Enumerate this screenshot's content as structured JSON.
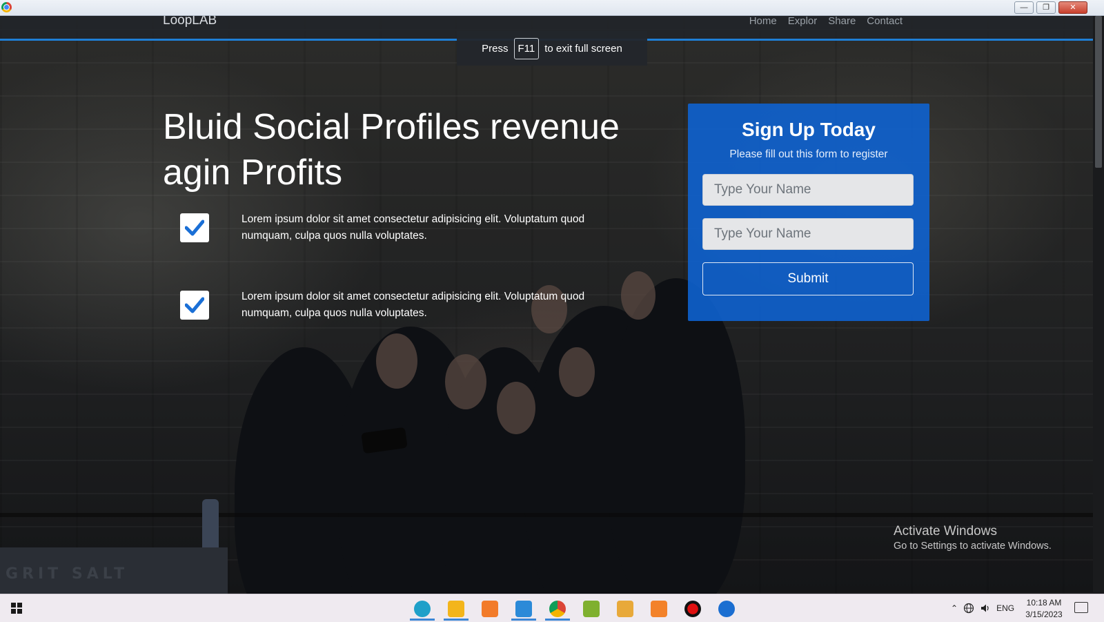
{
  "window": {
    "minimize_glyph": "—",
    "restore_glyph": "❐",
    "close_glyph": "✕"
  },
  "navbar": {
    "brand": "LoopLAB",
    "links": [
      "Home",
      "Explor",
      "Share",
      "Contact"
    ]
  },
  "fullscreen_banner": {
    "before": "Press",
    "key": "F11",
    "after": "to exit full screen"
  },
  "hero": {
    "headline": "Bluid Social Profiles revenue agin Profits",
    "features": [
      {
        "checked": true,
        "text": "Lorem ipsum dolor sit amet consectetur adipisicing elit. Voluptatum quod numquam, culpa quos nulla voluptates."
      },
      {
        "checked": true,
        "text": "Lorem ipsum dolor sit amet consectetur adipisicing elit. Voluptatum quod numquam, culpa quos nulla voluptates."
      }
    ]
  },
  "signup": {
    "title": "Sign Up Today",
    "subtitle": "Please fill out this form to register",
    "fields": [
      {
        "placeholder": "Type Your Name",
        "value": ""
      },
      {
        "placeholder": "Type Your Name",
        "value": ""
      }
    ],
    "submit_label": "Submit",
    "card_color": "#0e63d4"
  },
  "background": {
    "sign_text": "GRIT SALT"
  },
  "watermark": {
    "title": "Activate Windows",
    "subtitle": "Go to Settings to activate Windows."
  },
  "taskbar": {
    "apps": [
      {
        "name": "edge",
        "icon": "edge-icon",
        "color": "#1fa0c9",
        "active": true
      },
      {
        "name": "file-explorer",
        "icon": "folder-icon",
        "color": "#f3b51b",
        "active": true
      },
      {
        "name": "sublime",
        "icon": "sublime-icon",
        "color": "#f27b2a",
        "active": false
      },
      {
        "name": "vscode",
        "icon": "vscode-icon",
        "color": "#2b8ad8",
        "active": true
      },
      {
        "name": "chrome",
        "icon": "chrome-icon",
        "color": "#e34233",
        "active": true
      },
      {
        "name": "lambda",
        "icon": "lambda-icon",
        "color": "#7fb02f",
        "active": false
      },
      {
        "name": "gitkraken",
        "icon": "diamond-icon",
        "color": "#e8a93a",
        "active": false
      },
      {
        "name": "xampp",
        "icon": "xampp-icon",
        "color": "#f3822a",
        "active": false
      },
      {
        "name": "recorder",
        "icon": "record-icon",
        "color": "#e01010",
        "active": false
      },
      {
        "name": "davinci",
        "icon": "davinci-icon",
        "color": "#1b6ed1",
        "active": false
      }
    ],
    "tray": {
      "lang": "ENG",
      "time": "10:18 AM",
      "date": "3/15/2023"
    }
  }
}
